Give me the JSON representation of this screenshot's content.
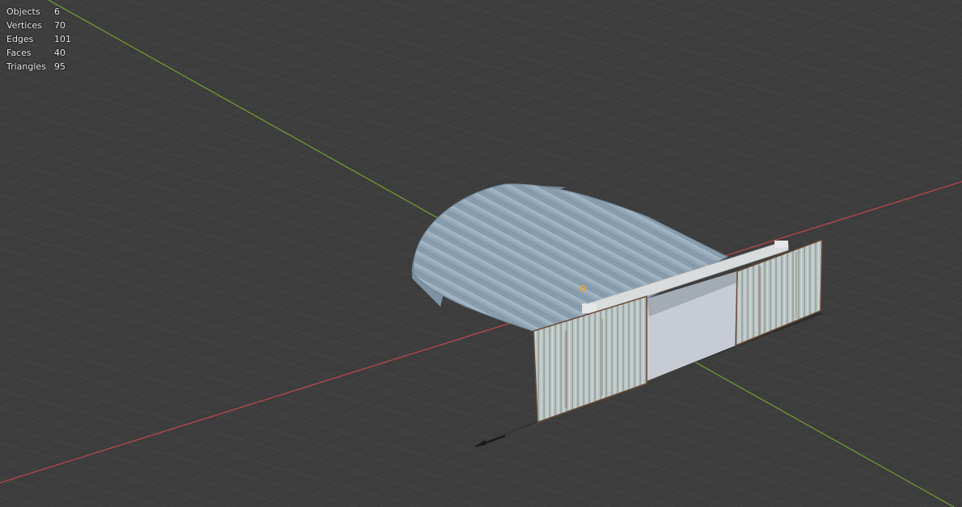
{
  "app": "Blender 3D Viewport",
  "scene_stats": [
    {
      "label": "Objects",
      "value": "6"
    },
    {
      "label": "Vertices",
      "value": "70"
    },
    {
      "label": "Edges",
      "value": "101"
    },
    {
      "label": "Faces",
      "value": "40"
    },
    {
      "label": "Triangles",
      "value": "95"
    }
  ],
  "viewport": {
    "background_color": "#3d3d3d",
    "grid_color": "#4a4a4a",
    "x_axis_color": "#b8474e",
    "y_axis_color": "#6e9a2e",
    "origin_marker_color": "#f0a020"
  },
  "scene": {
    "object": "quonset-hut-hangar",
    "roof_color": "#9fb1bf",
    "wall_panel_color": "#b9c4c4",
    "floor_color": "#c7ccd4"
  }
}
